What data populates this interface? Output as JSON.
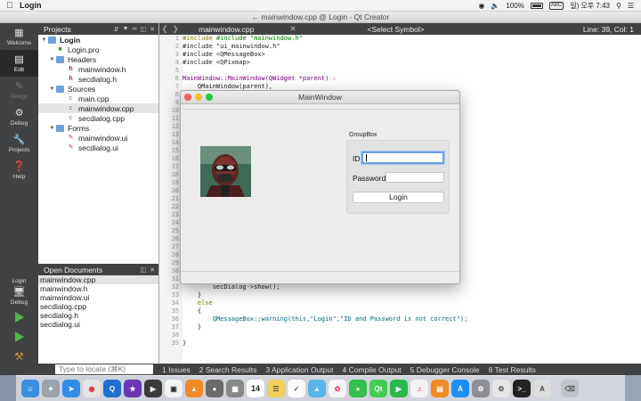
{
  "menubar": {
    "app_name": "Login",
    "battery": "100%",
    "input": "ABC",
    "clock": "일) 오후 7:43"
  },
  "qt": {
    "window_title": "← mainwindow.cpp @ Login - Qt Creator",
    "modes": [
      {
        "label": "Welcome",
        "icon": "grid-icon"
      },
      {
        "label": "Edit",
        "icon": "edit-icon"
      },
      {
        "label": "Design",
        "icon": "pencil-icon"
      },
      {
        "label": "Debug",
        "icon": "bug-icon"
      },
      {
        "label": "Projects",
        "icon": "wrench-icon"
      },
      {
        "label": "Help",
        "icon": "help-icon"
      }
    ],
    "run_target": {
      "label": "Login",
      "sub_label": "Debug"
    },
    "projects_header": "Projects",
    "tree": {
      "root": "Login",
      "pro": "Login.pro",
      "headers": "Headers",
      "header_files": [
        "mainwindow.h",
        "secdialog.h"
      ],
      "sources": "Sources",
      "source_files": [
        "main.cpp",
        "mainwindow.cpp",
        "secdialog.cpp"
      ],
      "forms": "Forms",
      "form_files": [
        "mainwindow.ui",
        "secdialog.ui"
      ]
    },
    "open_docs_header": "Open Documents",
    "open_docs": [
      "mainwindow.cpp",
      "mainwindow.h",
      "mainwindow.ui",
      "secdialog.cpp",
      "secdialog.h",
      "secdialog.ui"
    ],
    "editor_file": "mainwindow.cpp",
    "symbol": "<Select Symbol>",
    "line_col": "Line: 39, Col: 1",
    "line_numbers": [
      "1",
      "2",
      "3",
      "4",
      "5",
      "6",
      "7",
      "8",
      "9",
      "10",
      "11",
      "12",
      "13",
      "14",
      "15",
      "16",
      "17",
      "18",
      "19",
      "20",
      "21",
      "22",
      "23",
      "24",
      "25",
      "26",
      "27",
      "28",
      "29",
      "30",
      "31",
      "32",
      "33",
      "34",
      "35",
      "36",
      "37",
      "38",
      "39"
    ],
    "code": {
      "l1": "#include \"mainwindow.h\"",
      "l2": "#include \"ui_mainwindow.h\"",
      "l3": "#include <QMessageBox>",
      "l4": "#include <QPixmap>",
      "l6": "MainWindow::MainWindow(QWidget *parent) :",
      "l7": "    QMainWindow(parent),",
      "l31": "        secDialog->show();",
      "l32": "    }",
      "l33": "    else",
      "l34": "    {",
      "l35": "        QMessageBox::warning(this,\"Login\",\"ID and Password is not correct\");",
      "l36": "    }",
      "l38": "}"
    },
    "status": {
      "locate_placeholder": "Type to locate (⌘K)",
      "tabs": [
        "1 Issues",
        "2 Search Results",
        "3 Application Output",
        "4 Compile Output",
        "5 Debugger Console",
        "8 Test Results"
      ]
    }
  },
  "login_window": {
    "title": "MainWindow",
    "groupbox_title": "GroupBox",
    "id_label": "ID",
    "id_value": "",
    "password_label": "Password",
    "password_value": "",
    "login_button": "Login"
  },
  "dock": {
    "calendar_day": "14"
  }
}
